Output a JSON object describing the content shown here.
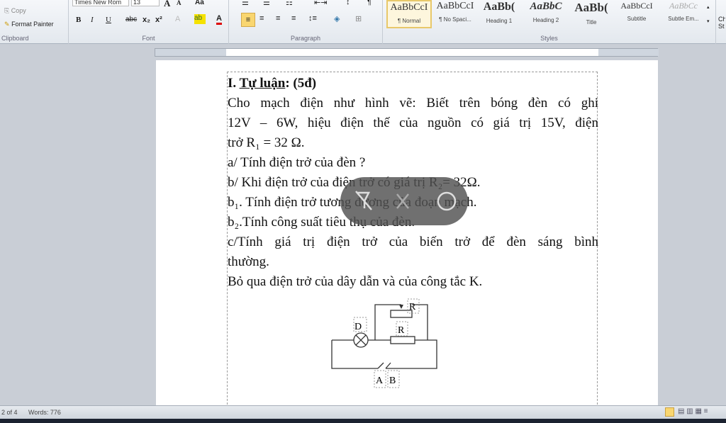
{
  "ribbon": {
    "clipboard": {
      "copy": "Copy",
      "format_painter": "Format Painter",
      "label": "Clipboard"
    },
    "font": {
      "name": "Times New Rom",
      "size": "13",
      "label": "Font",
      "bold": "B",
      "italic": "I",
      "underline": "U",
      "grow": "A",
      "shrink": "A",
      "case": "Aa"
    },
    "paragraph": {
      "label": "Paragraph"
    },
    "styles": {
      "label": "Styles",
      "items": [
        {
          "sample": "AaBbCcI",
          "name": "¶ Normal"
        },
        {
          "sample": "AaBbCcI",
          "name": "¶ No Spaci..."
        },
        {
          "sample": "AaBb(",
          "name": "Heading 1"
        },
        {
          "sample": "AaBbC",
          "name": "Heading 2"
        },
        {
          "sample": "AaBb(",
          "name": "Title"
        },
        {
          "sample": "AaBbCcI",
          "name": "Subtitle"
        },
        {
          "sample": "AaBbCc",
          "name": "Subtle Em..."
        }
      ],
      "change_styles": "Ch St"
    }
  },
  "document": {
    "heading_num": "I. ",
    "heading_u": "Tự luận",
    "heading_rest": ": (5đ)",
    "lines": [
      " Cho mạch điện như hình vẽ: Biết trên bóng đèn có ghi",
      "12V – 6W, hiệu điện thế của nguồn có giá  trị 15V, điện",
      "trở R₁ = 32 Ω.",
      "a/ Tính điện trở của đèn ?",
      "b/ Khi điện trở của điện trở có giá trị R₂= 32Ω.",
      "b₁. Tính điện trở tương đương của đoạn mạch.",
      "b₂.Tính công suất tiêu thụ của đèn.",
      "c/Tính giá trị điện trở của biến trở để đèn sáng bình",
      "thường.",
      "Bỏ qua điện trở của dây dẫn và của công tắc K."
    ],
    "circuit": {
      "lamp": "D",
      "rheostat": "R",
      "resistor": "R",
      "a": "A",
      "b": "B"
    }
  },
  "status": {
    "page": "2 of 4",
    "words": "Words: 776"
  }
}
